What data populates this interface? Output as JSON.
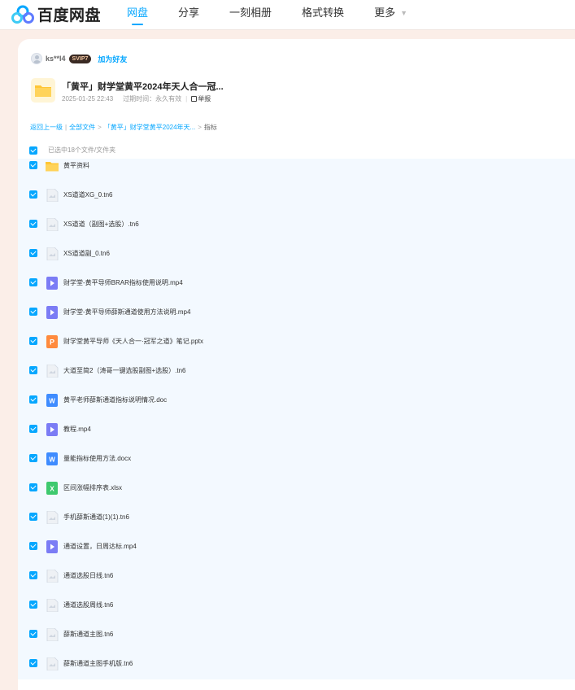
{
  "brand": {
    "name": "百度网盘"
  },
  "nav": [
    {
      "label": "网盘",
      "active": true
    },
    {
      "label": "分享",
      "active": false
    },
    {
      "label": "一刻相册",
      "active": false
    },
    {
      "label": "格式转换",
      "active": false
    },
    {
      "label": "更多",
      "active": false,
      "dropdown": true
    }
  ],
  "sharer": {
    "name": "ks**l4",
    "badge": "SVIP7",
    "add_friend": "加为好友"
  },
  "share": {
    "title": "「黄平」财学堂黄平2024年天人合一冠...",
    "date": "2025-01-25 22:43",
    "expiry": "过期时间：永久有效",
    "report": "举报"
  },
  "breadcrumb": {
    "back": "返回上一级",
    "all": "全部文件",
    "folder": "「黄平」财学堂黄平2024年天...",
    "current": "指标"
  },
  "selection": {
    "text": "已选中18个文件/文件夹"
  },
  "files": [
    {
      "name": "黄平资料",
      "icon": "folder"
    },
    {
      "name": "XS道道XG_0.tn6",
      "icon": "generic"
    },
    {
      "name": "XS道道（副图+选股）.tn6",
      "icon": "generic"
    },
    {
      "name": "XS道道副_0.tn6",
      "icon": "generic"
    },
    {
      "name": "财学堂-黄平导师BRAR指标使用说明.mp4",
      "icon": "video"
    },
    {
      "name": "财学堂-黄平导师薛斯通道使用方法说明.mp4",
      "icon": "video"
    },
    {
      "name": "财学堂黄平导师《天人合一·冠军之道》笔记.pptx",
      "icon": "ppt"
    },
    {
      "name": "大道至简2（涛哥一键选股副图+选股）.tn6",
      "icon": "generic"
    },
    {
      "name": "黄平老师薛斯通道指标说明情况.doc",
      "icon": "word"
    },
    {
      "name": "教程.mp4",
      "icon": "video"
    },
    {
      "name": "量能指标使用方法.docx",
      "icon": "word"
    },
    {
      "name": "区间涨幅排序表.xlsx",
      "icon": "excel"
    },
    {
      "name": "手机薛斯通道(1)(1).tn6",
      "icon": "generic"
    },
    {
      "name": "通道设置，日周达标.mp4",
      "icon": "video"
    },
    {
      "name": "通道选股日线.tn6",
      "icon": "generic"
    },
    {
      "name": "通道选股周线.tn6",
      "icon": "generic"
    },
    {
      "name": "薛斯通道主图.tn6",
      "icon": "generic"
    },
    {
      "name": "薛斯通道主图手机版.tn6",
      "icon": "generic"
    }
  ],
  "colors": {
    "accent": "#06a7ff",
    "list_bg": "#f3f9ff",
    "page_bg": "#fbeee8",
    "folder": "#ffc634",
    "video": "#7b7cf5",
    "ppt": "#ff8a3d",
    "word": "#3f8cff",
    "excel": "#3ec96e",
    "generic": "#cfd6e0"
  }
}
